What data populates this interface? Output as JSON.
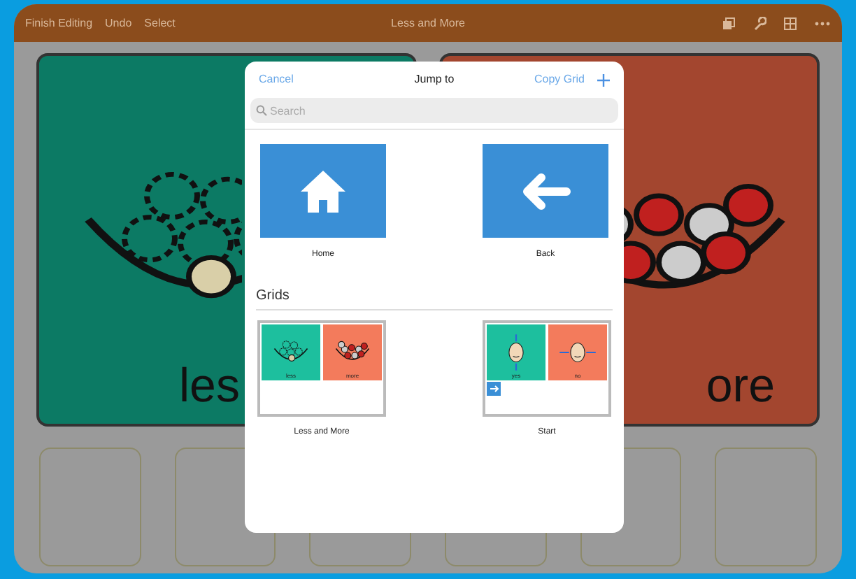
{
  "top_bar": {
    "left_buttons": [
      "Finish Editing",
      "Undo",
      "Select"
    ],
    "title": "Less and More"
  },
  "board": {
    "cells": [
      {
        "label": "les",
        "color": "#0c7a64",
        "kind": "less"
      },
      {
        "label": "ore",
        "color": "#a3462f",
        "kind": "more"
      }
    ],
    "bottom_row": [
      {
        "kind": "empty"
      },
      {
        "kind": "empty"
      },
      {
        "kind": "empty"
      },
      {
        "kind": "empty"
      },
      {
        "kind": "empty"
      },
      {
        "kind": "empty"
      }
    ]
  },
  "dialog": {
    "cancel": "Cancel",
    "title": "Jump to",
    "copy": "Copy Grid",
    "search": {
      "placeholder": "Search"
    },
    "shortcuts": [
      {
        "label": "Home",
        "kind": "home"
      },
      {
        "label": "Back",
        "kind": "back"
      }
    ],
    "section": "Grids",
    "grids": [
      {
        "label": "Less and More",
        "link_button": false,
        "cells": [
          {
            "label": "less",
            "color": "#1dbf9e",
            "kind": "less"
          },
          {
            "label": "more",
            "color": "#f37b5c",
            "kind": "more"
          }
        ]
      },
      {
        "label": "Start",
        "link_button": true,
        "cells": [
          {
            "label": "yes",
            "color": "#1dbf9e",
            "kind": "yes"
          },
          {
            "label": "no",
            "color": "#f37b5c",
            "kind": "no"
          }
        ]
      }
    ]
  }
}
